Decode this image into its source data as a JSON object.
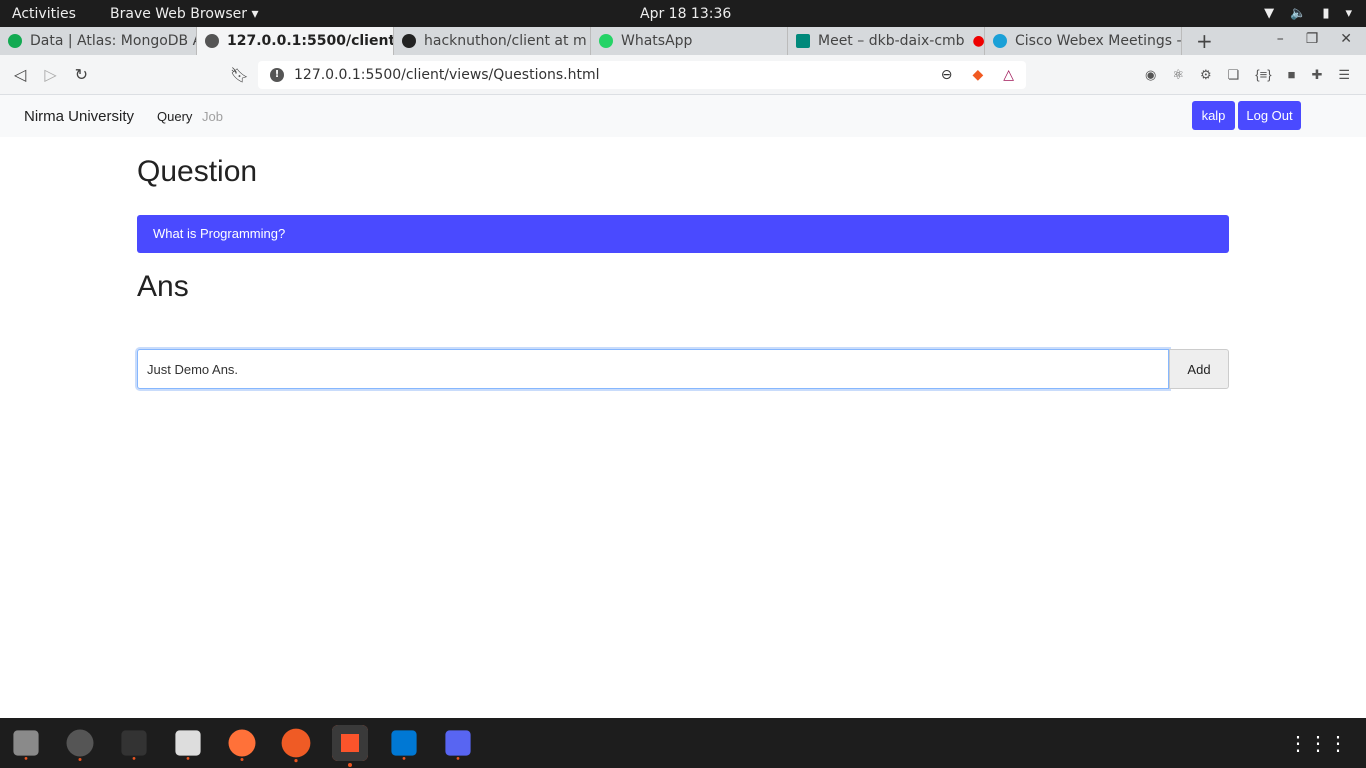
{
  "system": {
    "activities": "Activities",
    "app_name": "Brave Web Browser ▾",
    "clock": "Apr 18  13:36"
  },
  "tabs": [
    {
      "title": "Data | Atlas: MongoDB A",
      "color": "#13aa52"
    },
    {
      "title": "127.0.0.1:5500/client",
      "color": "#555555",
      "active": true
    },
    {
      "title": "hacknuthon/client at m",
      "color": "#222222"
    },
    {
      "title": "WhatsApp",
      "color": "#25d366"
    },
    {
      "title": "Meet – dkb-daix-cmb",
      "color": "#00897b"
    },
    {
      "title": "Cisco Webex Meetings -",
      "color": "#1ba0d7"
    }
  ],
  "browser": {
    "url": "127.0.0.1:5500/client/views/Questions.html"
  },
  "navbar": {
    "brand": "Nirma University",
    "links": [
      "Query",
      "Job"
    ],
    "user_button": "kalp",
    "logout_button": "Log Out"
  },
  "page": {
    "question_heading": "Question",
    "question_text": "What is Programming?",
    "answer_heading": "Ans",
    "answer_value": "Just Demo Ans.",
    "add_button": "Add"
  },
  "colors": {
    "accent": "#4a4aff"
  }
}
